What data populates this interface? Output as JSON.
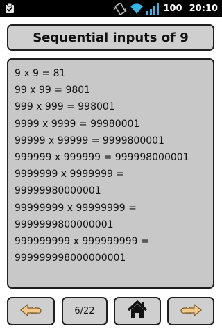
{
  "status_bar": {
    "battery": "100",
    "time": "20:10"
  },
  "title": "Sequential inputs of 9",
  "lines": [
    "9 x 9 = 81",
    "99 x 99 = 9801",
    "999 x 999 = 998001",
    "9999 x 9999 = 99980001",
    "99999 x 99999 = 9999800001",
    "999999 x 999999 = 999998000001",
    "9999999 x 9999999 =",
    "99999980000001",
    "99999999 x 99999999 =",
    "9999999800000001",
    "999999999 x 999999999 =",
    "999999998000000001"
  ],
  "nav": {
    "page_indicator": "6/22"
  },
  "icons": {
    "status_left": "clipboard-check-icon",
    "vibrate": "vibrate-icon",
    "wifi": "wifi-icon",
    "signal": "signal-icon",
    "prev": "hand-left-icon",
    "home": "home-icon",
    "next": "hand-right-icon"
  },
  "colors": {
    "panel_bg": "#c8c8c8",
    "button_bg": "#cfcfcf",
    "border": "#202020",
    "status_bar_bg": "#000000",
    "wifi_accent": "#33b5e5"
  }
}
